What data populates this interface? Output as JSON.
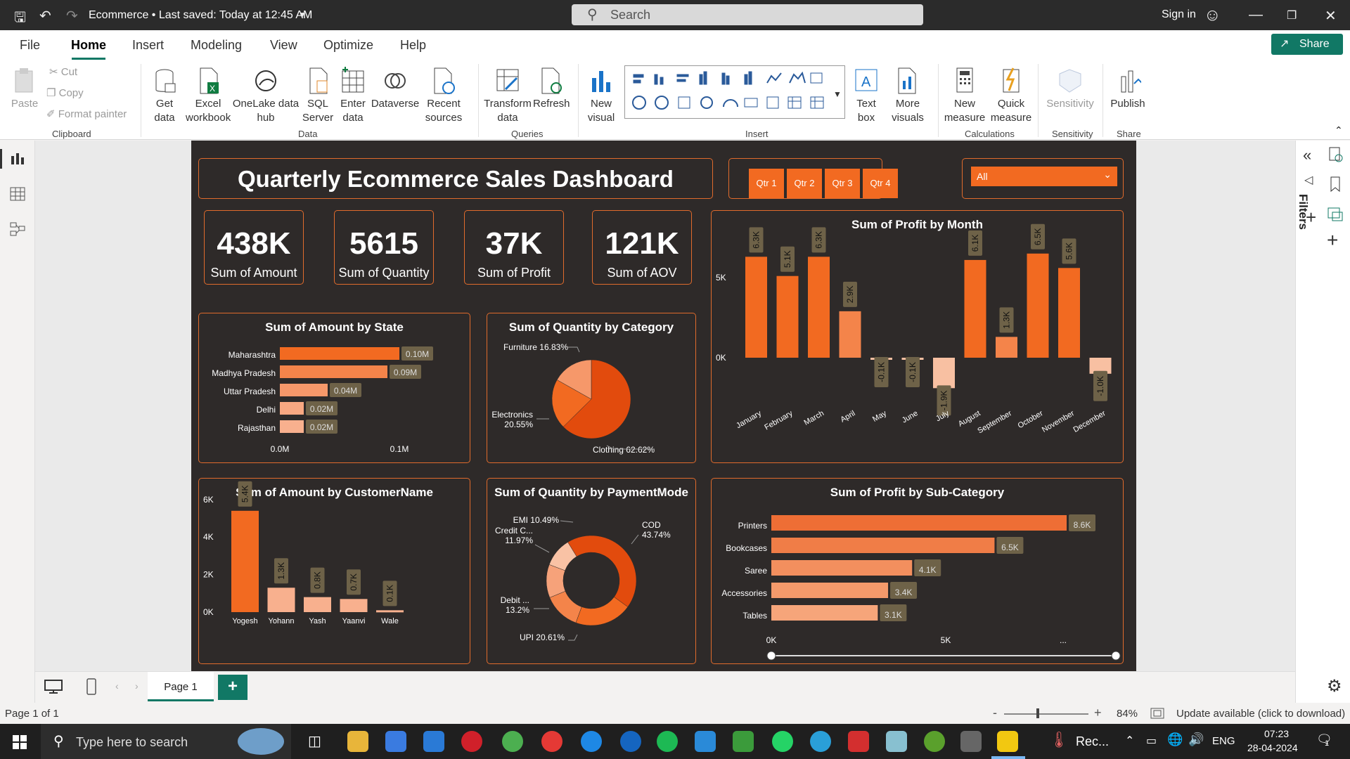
{
  "titlebar": {
    "doc_title": "Ecommerce • Last saved: Today at 12:45 AM",
    "search_placeholder": "Search",
    "signin": "Sign in"
  },
  "menu": [
    "File",
    "Home",
    "Insert",
    "Modeling",
    "View",
    "Optimize",
    "Help"
  ],
  "share": "Share",
  "ribbon": {
    "clipboard": {
      "paste": "Paste",
      "cut": "Cut",
      "copy": "Copy",
      "format_painter": "Format painter",
      "group": "Clipboard"
    },
    "data": {
      "items": [
        "Get data",
        "Excel workbook",
        "OneLake data hub",
        "SQL Server",
        "Enter data",
        "Dataverse",
        "Recent sources"
      ],
      "group": "Data"
    },
    "queries": {
      "items": [
        "Transform data",
        "Refresh"
      ],
      "group": "Queries"
    },
    "insert": {
      "new_visual": "New visual",
      "text_box": "Text box",
      "more_visuals": "More visuals",
      "group": "Insert"
    },
    "calculations": {
      "items": [
        "New measure",
        "Quick measure"
      ],
      "group": "Calculations"
    },
    "sensitivity": {
      "item": "Sensitivity",
      "group": "Sensitivity"
    },
    "share": {
      "item": "Publish",
      "group": "Share"
    }
  },
  "right_pane": {
    "filters": "Filters"
  },
  "dashboard": {
    "title": "Quarterly Ecommerce Sales Dashboard",
    "quarters": [
      "Qtr 1",
      "Qtr 2",
      "Qtr 3",
      "Qtr 4"
    ],
    "slicer_value": "All",
    "kpis": [
      {
        "value": "438K",
        "label": "Sum of Amount"
      },
      {
        "value": "5615",
        "label": "Sum of Quantity"
      },
      {
        "value": "37K",
        "label": "Sum of Profit"
      },
      {
        "value": "121K",
        "label": "Sum of AOV"
      }
    ],
    "colors": {
      "accent": "#f26a21",
      "border": "#e06b2c",
      "background": "#2e2a29",
      "label_bg": "#6e6248"
    }
  },
  "chart_data": [
    {
      "id": "amount_by_state",
      "type": "bar",
      "orientation": "horizontal",
      "title": "Sum of Amount by State",
      "categories": [
        "Maharashtra",
        "Madhya Pradesh",
        "Uttar Pradesh",
        "Delhi",
        "Rajasthan"
      ],
      "values": [
        0.1,
        0.09,
        0.04,
        0.02,
        0.02
      ],
      "value_labels": [
        "0.10M",
        "0.09M",
        "0.04M",
        "0.02M",
        "0.02M"
      ],
      "xticks": [
        "0.0M",
        "0.1M"
      ],
      "xlim": [
        0,
        0.1
      ]
    },
    {
      "id": "quantity_by_category",
      "type": "pie",
      "title": "Sum of Quantity by Category",
      "categories": [
        "Clothing",
        "Electronics",
        "Furniture"
      ],
      "values": [
        62.62,
        20.55,
        16.83
      ],
      "labels": [
        "Clothing 62.62%",
        "Electronics 20.55%",
        "Furniture 16.83%"
      ],
      "colors": [
        "#e24b0d",
        "#f26a21",
        "#f6986a"
      ]
    },
    {
      "id": "profit_by_month",
      "type": "bar",
      "title": "Sum of Profit by Month",
      "categories": [
        "January",
        "February",
        "March",
        "April",
        "May",
        "June",
        "July",
        "August",
        "September",
        "October",
        "November",
        "December"
      ],
      "values": [
        6.3,
        5.1,
        6.3,
        2.9,
        -0.1,
        -0.1,
        -1.9,
        6.1,
        1.3,
        6.5,
        5.6,
        -1.0
      ],
      "value_labels": [
        "6.3K",
        "5.1K",
        "6.3K",
        "2.9K",
        "-0.1K",
        "-0.1K",
        "-1.9K",
        "6.1K",
        "1.3K",
        "6.5K",
        "5.6K",
        "-1.0K"
      ],
      "yticks": [
        "5K",
        "0K"
      ],
      "ylim": [
        -2,
        7
      ]
    },
    {
      "id": "amount_by_customer",
      "type": "bar",
      "title": "Sum of Amount by CustomerName",
      "categories": [
        "Yogesh",
        "Yohann",
        "Yash",
        "Yaanvi",
        "Wale"
      ],
      "values": [
        5.4,
        1.3,
        0.8,
        0.7,
        0.1
      ],
      "value_labels": [
        "5.4K",
        "1.3K",
        "0.8K",
        "0.7K",
        "0.1K"
      ],
      "yticks": [
        "6K",
        "4K",
        "2K",
        "0K"
      ],
      "ylim": [
        0,
        6
      ]
    },
    {
      "id": "quantity_by_paymentmode",
      "type": "pie",
      "donut": true,
      "title": "Sum of Quantity by PaymentMode",
      "categories": [
        "COD",
        "UPI",
        "Debit ...",
        "Credit C...",
        "EMI"
      ],
      "values": [
        43.74,
        20.61,
        13.2,
        11.97,
        10.49
      ],
      "labels": [
        "COD 43.74%",
        "UPI 20.61%",
        "Debit ... 13.2%",
        "Credit C... 11.97%",
        "EMI 10.49%"
      ],
      "colors": [
        "#e24b0d",
        "#f26a21",
        "#f4844a",
        "#f6a27a",
        "#f9c2a5"
      ]
    },
    {
      "id": "profit_by_subcategory",
      "type": "bar",
      "orientation": "horizontal",
      "title": "Sum of Profit by Sub-Category",
      "categories": [
        "Printers",
        "Bookcases",
        "Saree",
        "Accessories",
        "Tables"
      ],
      "values": [
        8.6,
        6.5,
        4.1,
        3.4,
        3.1
      ],
      "value_labels": [
        "8.6K",
        "6.5K",
        "4.1K",
        "3.4K",
        "3.1K"
      ],
      "xticks": [
        "0K",
        "5K",
        "..."
      ],
      "xlim": [
        0,
        8.6
      ]
    }
  ],
  "pagebar": {
    "tab": "Page 1"
  },
  "status": {
    "page": "Page 1 of 1",
    "zoom": "84%",
    "update": "Update available (click to download)"
  },
  "taskbar": {
    "search": "Type here to search",
    "rec": "Rec...",
    "lang": "ENG",
    "time": "07:23",
    "date": "28-04-2024",
    "notif": "1"
  }
}
